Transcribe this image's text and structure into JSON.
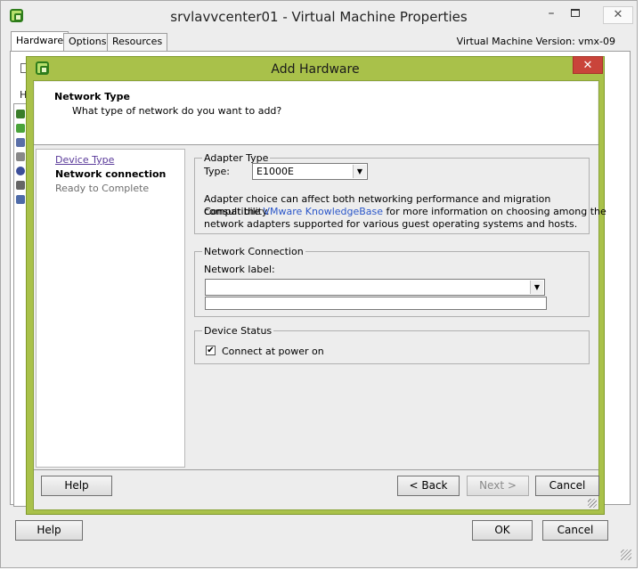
{
  "outer_window": {
    "title": "srvlavvcenter01 - Virtual Machine Properties",
    "minimize_glyph": "–",
    "close_glyph": "✕",
    "tabs": [
      {
        "label": "Hardware",
        "active": true
      },
      {
        "label": "Options",
        "active": false
      },
      {
        "label": "Resources",
        "active": false
      }
    ],
    "vm_version": "Virtual Machine Version: vmx-09",
    "partial_hardware_header": "H",
    "help_label": "Help",
    "ok_label": "OK",
    "cancel_label": "Cancel"
  },
  "dialog": {
    "title": "Add Hardware",
    "close_glyph": "✕",
    "header": {
      "title": "Network Type",
      "subtitle": "What type of network do you want to add?"
    },
    "nav": [
      {
        "label": "Device Type",
        "state": "link"
      },
      {
        "label": "Network connection",
        "state": "current"
      },
      {
        "label": "Ready to Complete",
        "state": "future"
      }
    ],
    "adapter_type": {
      "legend": "Adapter Type",
      "type_label": "Type:",
      "type_value": "E1000E",
      "info_line1": "Adapter choice can affect both networking performance and migration compatibility.",
      "info_line2_prefix": "Consult the ",
      "info_link": "VMware KnowledgeBase",
      "info_line2_suffix": " for more information on choosing among the",
      "info_line3": "network adapters supported for various guest operating systems and hosts."
    },
    "network_connection": {
      "legend": "Network Connection",
      "label": "Network label:",
      "value": ""
    },
    "device_status": {
      "legend": "Device Status",
      "connect_label": "Connect at power on",
      "connect_checked": true,
      "check_glyph": "✔"
    },
    "buttons": {
      "help": "Help",
      "back": "< Back",
      "next": "Next >",
      "cancel": "Cancel"
    }
  },
  "colors": {
    "dialog_frame": "#a9c14a",
    "close_button": "#c9443a",
    "link": "#2a56c9",
    "visited_link": "#5a3a9a"
  }
}
